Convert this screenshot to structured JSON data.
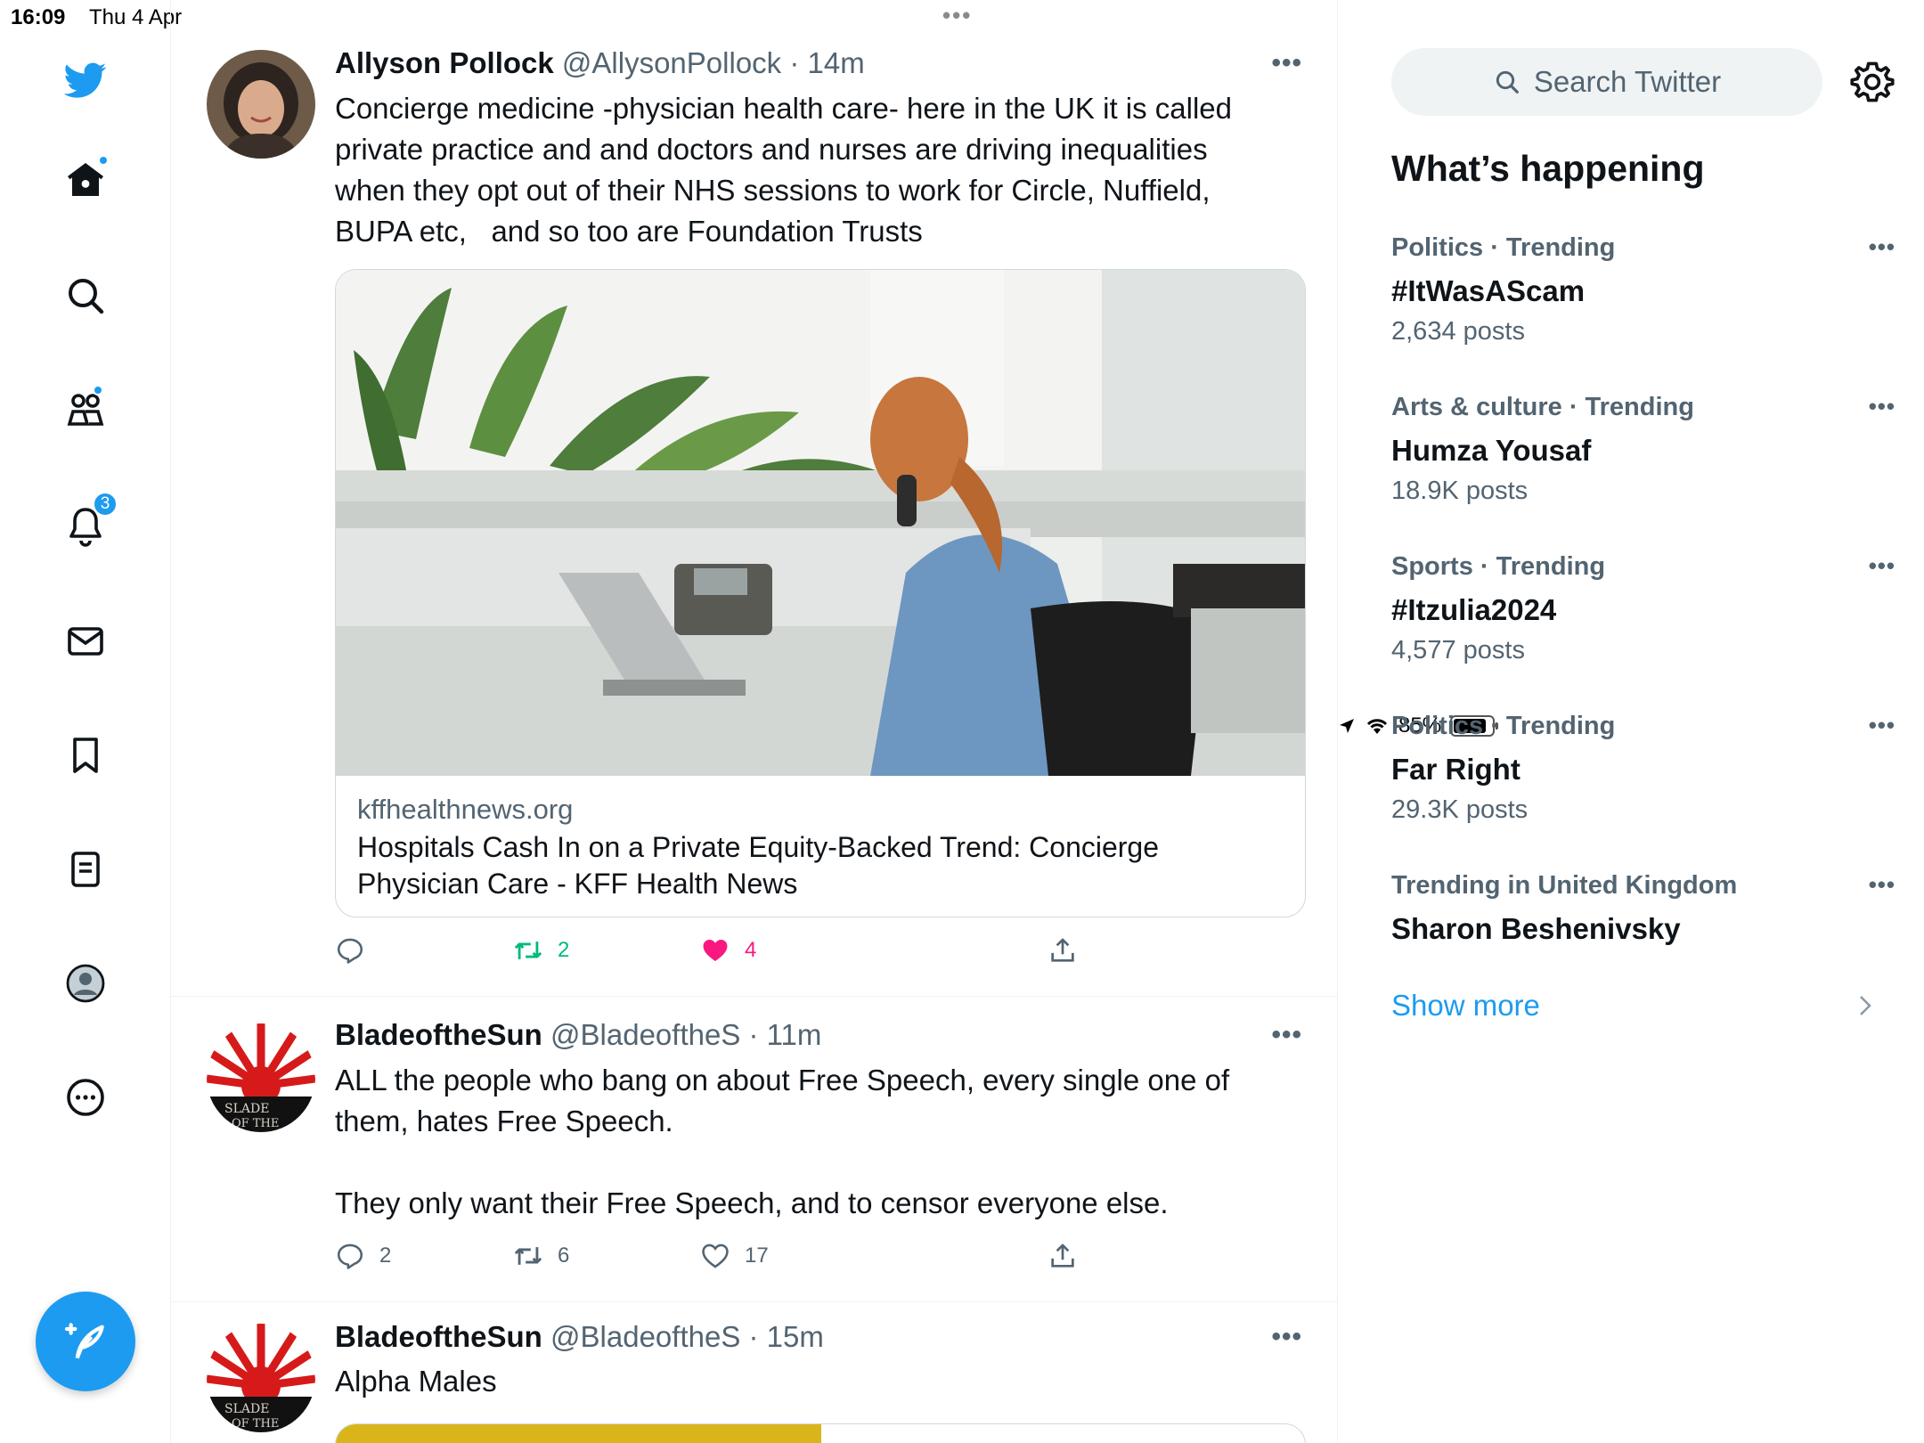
{
  "status_bar": {
    "time": "16:09",
    "date": "Thu 4 Apr",
    "battery_percent": "85%",
    "battery_level": 0.85
  },
  "sidebar": {
    "items": [
      {
        "name": "twitter-logo-icon"
      },
      {
        "name": "home-icon",
        "dot": true
      },
      {
        "name": "search-icon"
      },
      {
        "name": "communities-icon",
        "dot": true
      },
      {
        "name": "notifications-icon",
        "badge": "3"
      },
      {
        "name": "messages-icon"
      },
      {
        "name": "bookmarks-icon"
      },
      {
        "name": "lists-icon"
      },
      {
        "name": "profile-icon"
      },
      {
        "name": "more-icon"
      }
    ],
    "compose_icon": "compose-tweet-icon"
  },
  "timeline": {
    "tweets": [
      {
        "name": "Allyson Pollock",
        "handle": "@AllysonPollock",
        "time": "· 14m",
        "text": "Concierge medicine -physician health care- here in the UK it is called private practice and and doctors and nurses are driving inequalities when they opt out of their NHS sessions to work for Circle, Nuffield, BUPA etc,   and so too are Foundation Trusts",
        "card": {
          "domain": "kffhealthnews.org",
          "title": "Hospitals Cash In on a Private Equity-Backed Trend: Concierge Physician Care - KFF Health News"
        },
        "replies": "",
        "retweets": "2",
        "likes": "4",
        "liked": true,
        "retweeted": true
      },
      {
        "name": "BladeoftheSun",
        "handle": "@BladeoftheS",
        "time": "· 11m",
        "text": "ALL the people who bang on about Free Speech, every single one of them, hates Free Speech.\n\nThey only want their Free Speech, and to censor everyone else.",
        "replies": "2",
        "retweets": "6",
        "likes": "17"
      },
      {
        "name": "BladeoftheSun",
        "handle": "@BladeoftheS",
        "time": "· 15m",
        "text": "Alpha Males"
      }
    ]
  },
  "right": {
    "search_placeholder": "Search Twitter",
    "heading": "What’s happening",
    "trends": [
      {
        "context": "Politics · Trending",
        "name": "#ItWasAScam",
        "posts": "2,634 posts"
      },
      {
        "context": "Arts & culture · Trending",
        "name": "Humza Yousaf",
        "posts": "18.9K posts"
      },
      {
        "context": "Sports · Trending",
        "name": "#Itzulia2024",
        "posts": "4,577 posts"
      },
      {
        "context": "Politics · Trending",
        "name": "Far Right",
        "posts": "29.3K posts"
      },
      {
        "context": "Trending in United Kingdom",
        "name": "Sharon Beshenivsky",
        "posts": ""
      }
    ],
    "show_more": "Show more"
  },
  "colors": {
    "accent": "#1d9bf0",
    "like": "#f91880",
    "retweet": "#00ba7c",
    "secondary_text": "#536471"
  }
}
